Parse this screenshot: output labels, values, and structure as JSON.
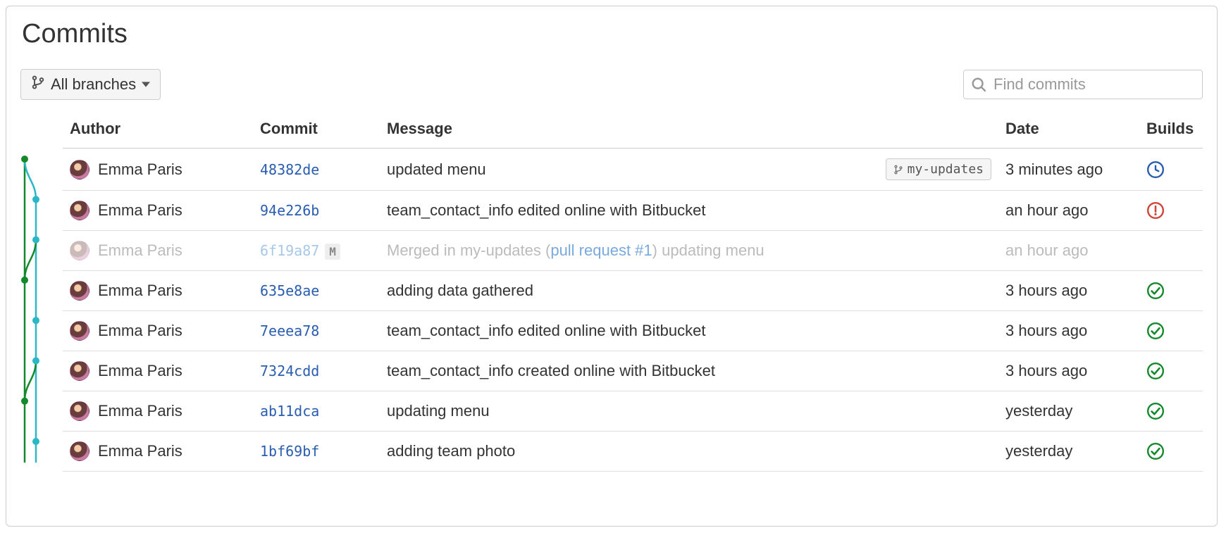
{
  "page": {
    "title": "Commits"
  },
  "toolbar": {
    "branch_selector_label": "All branches",
    "search_placeholder": "Find commits"
  },
  "table": {
    "headers": {
      "author": "Author",
      "commit": "Commit",
      "message": "Message",
      "date": "Date",
      "builds": "Builds"
    }
  },
  "commits": [
    {
      "author": "Emma Paris",
      "hash": "48382de",
      "message": "updated menu",
      "branch_tag": "my-updates",
      "date": "3 minutes ago",
      "build_status": "pending",
      "muted": false,
      "is_merge": false
    },
    {
      "author": "Emma Paris",
      "hash": "94e226b",
      "message": "team_contact_info edited online with Bitbucket",
      "branch_tag": null,
      "date": "an hour ago",
      "build_status": "failed",
      "muted": false,
      "is_merge": false
    },
    {
      "author": "Emma Paris",
      "hash": "6f19a87",
      "message_prefix": "Merged in my-updates (",
      "message_link": "pull request #1",
      "message_suffix_plain": ") ",
      "message_suffix_faded": "updating menu",
      "branch_tag": null,
      "date": "an hour ago",
      "build_status": "none",
      "muted": true,
      "is_merge": true,
      "merge_badge": "M"
    },
    {
      "author": "Emma Paris",
      "hash": "635e8ae",
      "message": "adding data gathered",
      "branch_tag": null,
      "date": "3 hours ago",
      "build_status": "success",
      "muted": false,
      "is_merge": false
    },
    {
      "author": "Emma Paris",
      "hash": "7eeea78",
      "message": "team_contact_info edited online with Bitbucket",
      "branch_tag": null,
      "date": "3 hours ago",
      "build_status": "success",
      "muted": false,
      "is_merge": false
    },
    {
      "author": "Emma Paris",
      "hash": "7324cdd",
      "message": "team_contact_info created online with Bitbucket",
      "branch_tag": null,
      "date": "3 hours ago",
      "build_status": "success",
      "muted": false,
      "is_merge": false
    },
    {
      "author": "Emma Paris",
      "hash": "ab11dca",
      "message": "updating menu",
      "branch_tag": null,
      "date": "yesterday",
      "build_status": "success",
      "muted": false,
      "is_merge": false
    },
    {
      "author": "Emma Paris",
      "hash": "1bf69bf",
      "message": "adding team photo",
      "branch_tag": null,
      "date": "yesterday",
      "build_status": "success",
      "muted": false,
      "is_merge": false
    }
  ],
  "colors": {
    "graph_green": "#14892c",
    "graph_teal": "#2ab8c6",
    "build_pending": "#2a5db0",
    "build_failed": "#d04437",
    "build_success": "#14892c"
  }
}
